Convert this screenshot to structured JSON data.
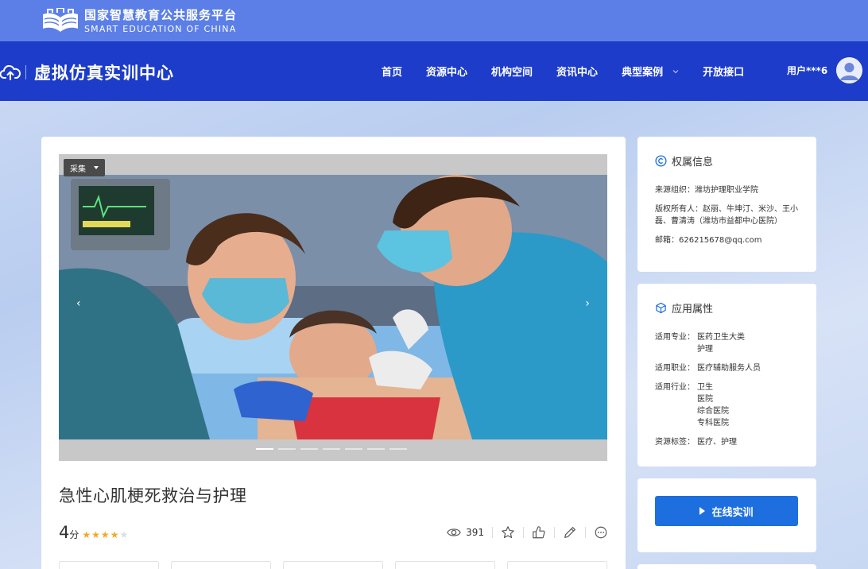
{
  "platform": {
    "name_cn": "国家智慧教育公共服务平台",
    "name_en": "SMART EDUCATION OF CHINA"
  },
  "nav": {
    "brand": "虚拟仿真实训中心",
    "items": [
      "首页",
      "资源中心",
      "机构空间",
      "资讯中心",
      "典型案例",
      "开放接口"
    ],
    "user": "用户***6"
  },
  "carousel": {
    "collect_label": "采集",
    "prev": "‹",
    "next": "›",
    "slide_count": 7,
    "active_slide": 1
  },
  "course": {
    "title": "急性心肌梗死救治与护理",
    "score": "4",
    "score_unit": "分",
    "stars_filled": 4,
    "stars_total": 5,
    "views": "391"
  },
  "ownership": {
    "title": "权属信息",
    "source_org": "来源组织：潍坊护理职业学院",
    "copyright_owner": "版权所有人：赵丽、牛坤汀、米沙、王小磊、曹清涛（潍坊市益都中心医院）",
    "email": "邮箱：626215678@qq.com"
  },
  "attributes": {
    "title": "应用属性",
    "rows": [
      {
        "label": "适用专业：",
        "values": [
          "医药卫生大类",
          "护理"
        ]
      },
      {
        "label": "适用职业：",
        "values": [
          "医疗辅助服务人员"
        ]
      },
      {
        "label": "适用行业：",
        "values": [
          "卫生",
          "医院",
          "综合医院",
          "专科医院"
        ]
      },
      {
        "label": "资源标签：",
        "values": [
          "医疗、护理"
        ]
      }
    ]
  },
  "launch": {
    "label": "在线实训"
  },
  "colors": {
    "top_banner": "#5b7fe6",
    "nav_bar": "#1c3cc9",
    "primary_button": "#1d6fe0",
    "star": "#f5a623"
  }
}
